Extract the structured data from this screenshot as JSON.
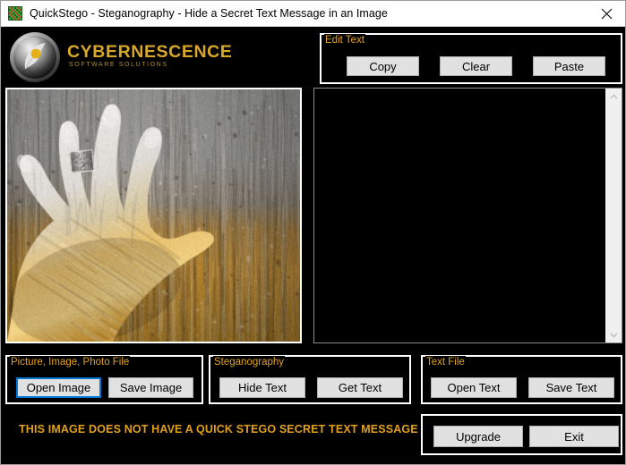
{
  "window": {
    "title": "QuickStego - Steganography - Hide a Secret Text Message in an Image",
    "app_icon": "quickstego-grid-icon",
    "close_label": "×",
    "background_color": "#000000",
    "accent_color": "#e3a21c"
  },
  "branding": {
    "name": "CYBERNESCENCE",
    "tagline": "SOFTWARE SOLUTIONS",
    "name_color": "#d8a828",
    "logo_icon": "sphere-leaf-logo-icon"
  },
  "edit_text_group": {
    "label": "Edit Text",
    "buttons": [
      {
        "label": "Copy",
        "name": "copy-button"
      },
      {
        "label": "Clear",
        "name": "clear-button"
      },
      {
        "label": "Paste",
        "name": "paste-button"
      }
    ]
  },
  "picture_panel": {
    "name": "picture-preview",
    "description": "Photograph of a left hand pressed against weathered wooden planks, top half desaturated gray and bottom half golden sepia, with a patterned ring on the ring finger."
  },
  "text_panel": {
    "value": "",
    "placeholder": "",
    "scrollbar": {
      "up_arrow": "chevron-up-icon",
      "down_arrow": "chevron-down-icon"
    }
  },
  "picture_file_group": {
    "label": "Picture, Image, Photo File",
    "buttons": [
      {
        "label": "Open Image",
        "name": "open-image-button",
        "focused": true
      },
      {
        "label": "Save Image",
        "name": "save-image-button",
        "focused": false
      }
    ]
  },
  "steganography_group": {
    "label": "Steganography",
    "buttons": [
      {
        "label": "Hide Text",
        "name": "hide-text-button"
      },
      {
        "label": "Get Text",
        "name": "get-text-button"
      }
    ]
  },
  "text_file_group": {
    "label": "Text File",
    "buttons": [
      {
        "label": "Open Text",
        "name": "open-text-button"
      },
      {
        "label": "Save Text",
        "name": "save-text-button"
      }
    ]
  },
  "actions_group": {
    "buttons": [
      {
        "label": "Upgrade",
        "name": "upgrade-button"
      },
      {
        "label": "Exit",
        "name": "exit-button"
      }
    ]
  },
  "status": {
    "message": "THIS IMAGE DOES NOT HAVE A QUICK STEGO SECRET TEXT MESSAGE",
    "color": "#e0a01e"
  }
}
